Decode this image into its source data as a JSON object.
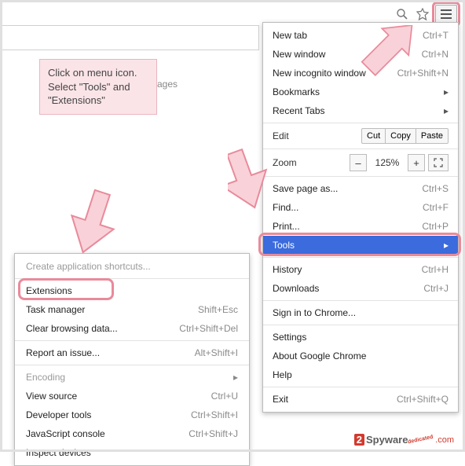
{
  "toolbar": {
    "zoom_icon": "zoom",
    "star_icon": "star",
    "menu_icon": "menu"
  },
  "callout": {
    "text": "Click on menu icon. Select \"Tools\" and \"Extensions\""
  },
  "bg_text": "ages",
  "main_menu": {
    "new_tab": {
      "label": "New tab",
      "shortcut": "Ctrl+T"
    },
    "new_window": {
      "label": "New window",
      "shortcut": "Ctrl+N"
    },
    "new_incognito": {
      "label": "New incognito window",
      "shortcut": "Ctrl+Shift+N"
    },
    "bookmarks": {
      "label": "Bookmarks"
    },
    "recent_tabs": {
      "label": "Recent Tabs"
    },
    "edit": {
      "label": "Edit",
      "cut": "Cut",
      "copy": "Copy",
      "paste": "Paste"
    },
    "zoom": {
      "label": "Zoom",
      "minus": "–",
      "value": "125%",
      "plus": "+"
    },
    "save_page": {
      "label": "Save page as...",
      "shortcut": "Ctrl+S"
    },
    "find": {
      "label": "Find...",
      "shortcut": "Ctrl+F"
    },
    "print": {
      "label": "Print...",
      "shortcut": "Ctrl+P"
    },
    "tools": {
      "label": "Tools"
    },
    "history": {
      "label": "History",
      "shortcut": "Ctrl+H"
    },
    "downloads": {
      "label": "Downloads",
      "shortcut": "Ctrl+J"
    },
    "signin": {
      "label": "Sign in to Chrome..."
    },
    "settings": {
      "label": "Settings"
    },
    "about": {
      "label": "About Google Chrome"
    },
    "help": {
      "label": "Help"
    },
    "exit": {
      "label": "Exit",
      "shortcut": "Ctrl+Shift+Q"
    }
  },
  "sub_menu": {
    "create_shortcuts": {
      "label": "Create application shortcuts..."
    },
    "extensions": {
      "label": "Extensions"
    },
    "task_manager": {
      "label": "Task manager",
      "shortcut": "Shift+Esc"
    },
    "clear_data": {
      "label": "Clear browsing data...",
      "shortcut": "Ctrl+Shift+Del"
    },
    "report_issue": {
      "label": "Report an issue...",
      "shortcut": "Alt+Shift+I"
    },
    "encoding": {
      "label": "Encoding"
    },
    "view_source": {
      "label": "View source",
      "shortcut": "Ctrl+U"
    },
    "dev_tools": {
      "label": "Developer tools",
      "shortcut": "Ctrl+Shift+I"
    },
    "js_console": {
      "label": "JavaScript console",
      "shortcut": "Ctrl+Shift+J"
    },
    "inspect_devices": {
      "label": "Inspect devices"
    }
  },
  "watermark": {
    "two": "2",
    "name": "Spyware",
    "com": ".com",
    "dedic": "dedicated"
  },
  "highlight_colors": {
    "pink_border": "#e98a9b",
    "callout_bg": "#fbe4e8",
    "menu_highlight": "#3b6bdc"
  }
}
